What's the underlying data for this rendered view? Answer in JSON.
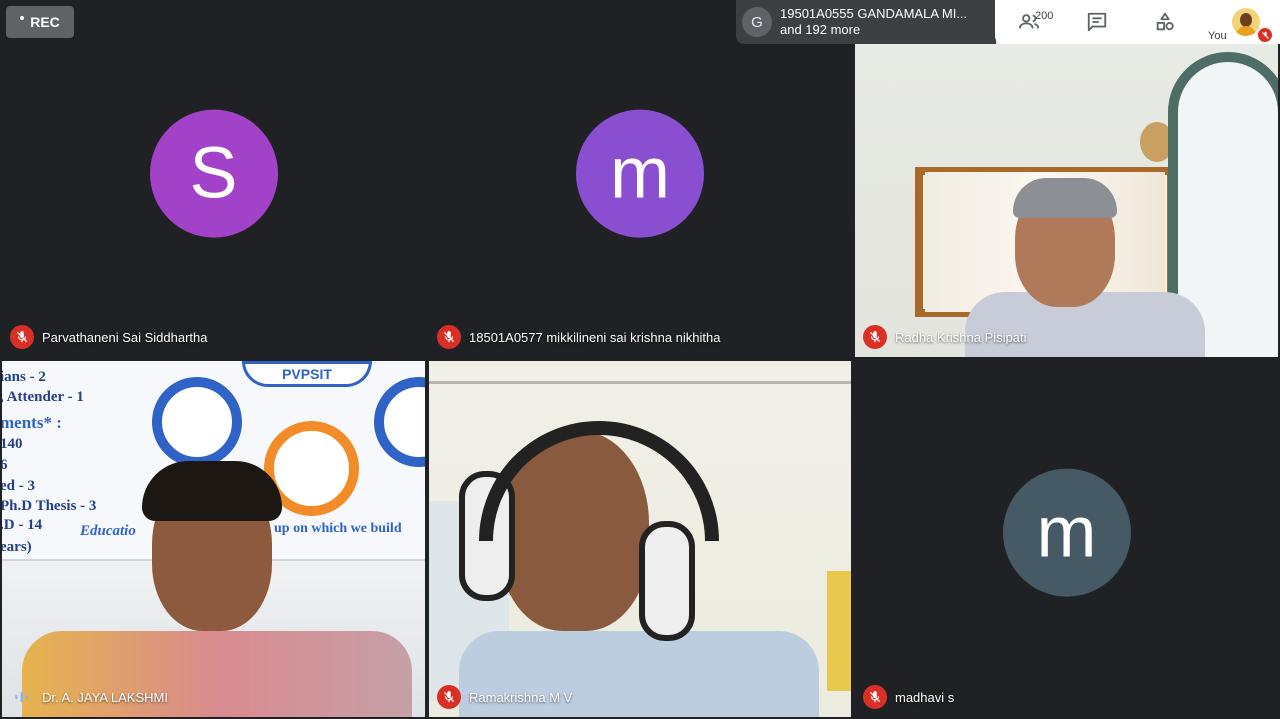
{
  "recording": {
    "label": "REC"
  },
  "notification": {
    "avatar_letter": "G",
    "line1": "19501A0555 GANDAMALA MI...",
    "line2": "and 192 more"
  },
  "toolbar": {
    "participants_count": "200",
    "you_label": "You"
  },
  "colors": {
    "mic_off": "#d93025",
    "avatar_s": "#a142c9",
    "avatar_m": "#8a4fd1",
    "avatar_m2": "#455a64"
  },
  "tiles": [
    {
      "name": "Parvathaneni Sai Siddhartha",
      "avatar": "S",
      "muted": true
    },
    {
      "name": "18501A0577 mikkilineni sai krishna nikhitha",
      "avatar": "m",
      "muted": true
    },
    {
      "name": "Radha Krishna Pisipati",
      "avatar": "",
      "muted": true
    },
    {
      "name": "Dr. A. JAYA LAKSHMI",
      "avatar": "",
      "muted": false
    },
    {
      "name": "Ramakrishna M V",
      "avatar": "",
      "muted": true
    },
    {
      "name": "madhavi s",
      "avatar": "m",
      "muted": true
    }
  ],
  "board_text": {
    "l1": "ians - 2",
    "l2": ", Attender - 1",
    "l3": "ments* :",
    "l4": "140",
    "l5": "6",
    "l6": "ed - 3",
    "l7": "Ph.D Thesis - 3",
    "l8": ".D - 14",
    "l9": "ears)",
    "l10": "Educatio",
    "l11": "up on which we build",
    "sign": "PVPSIT"
  }
}
